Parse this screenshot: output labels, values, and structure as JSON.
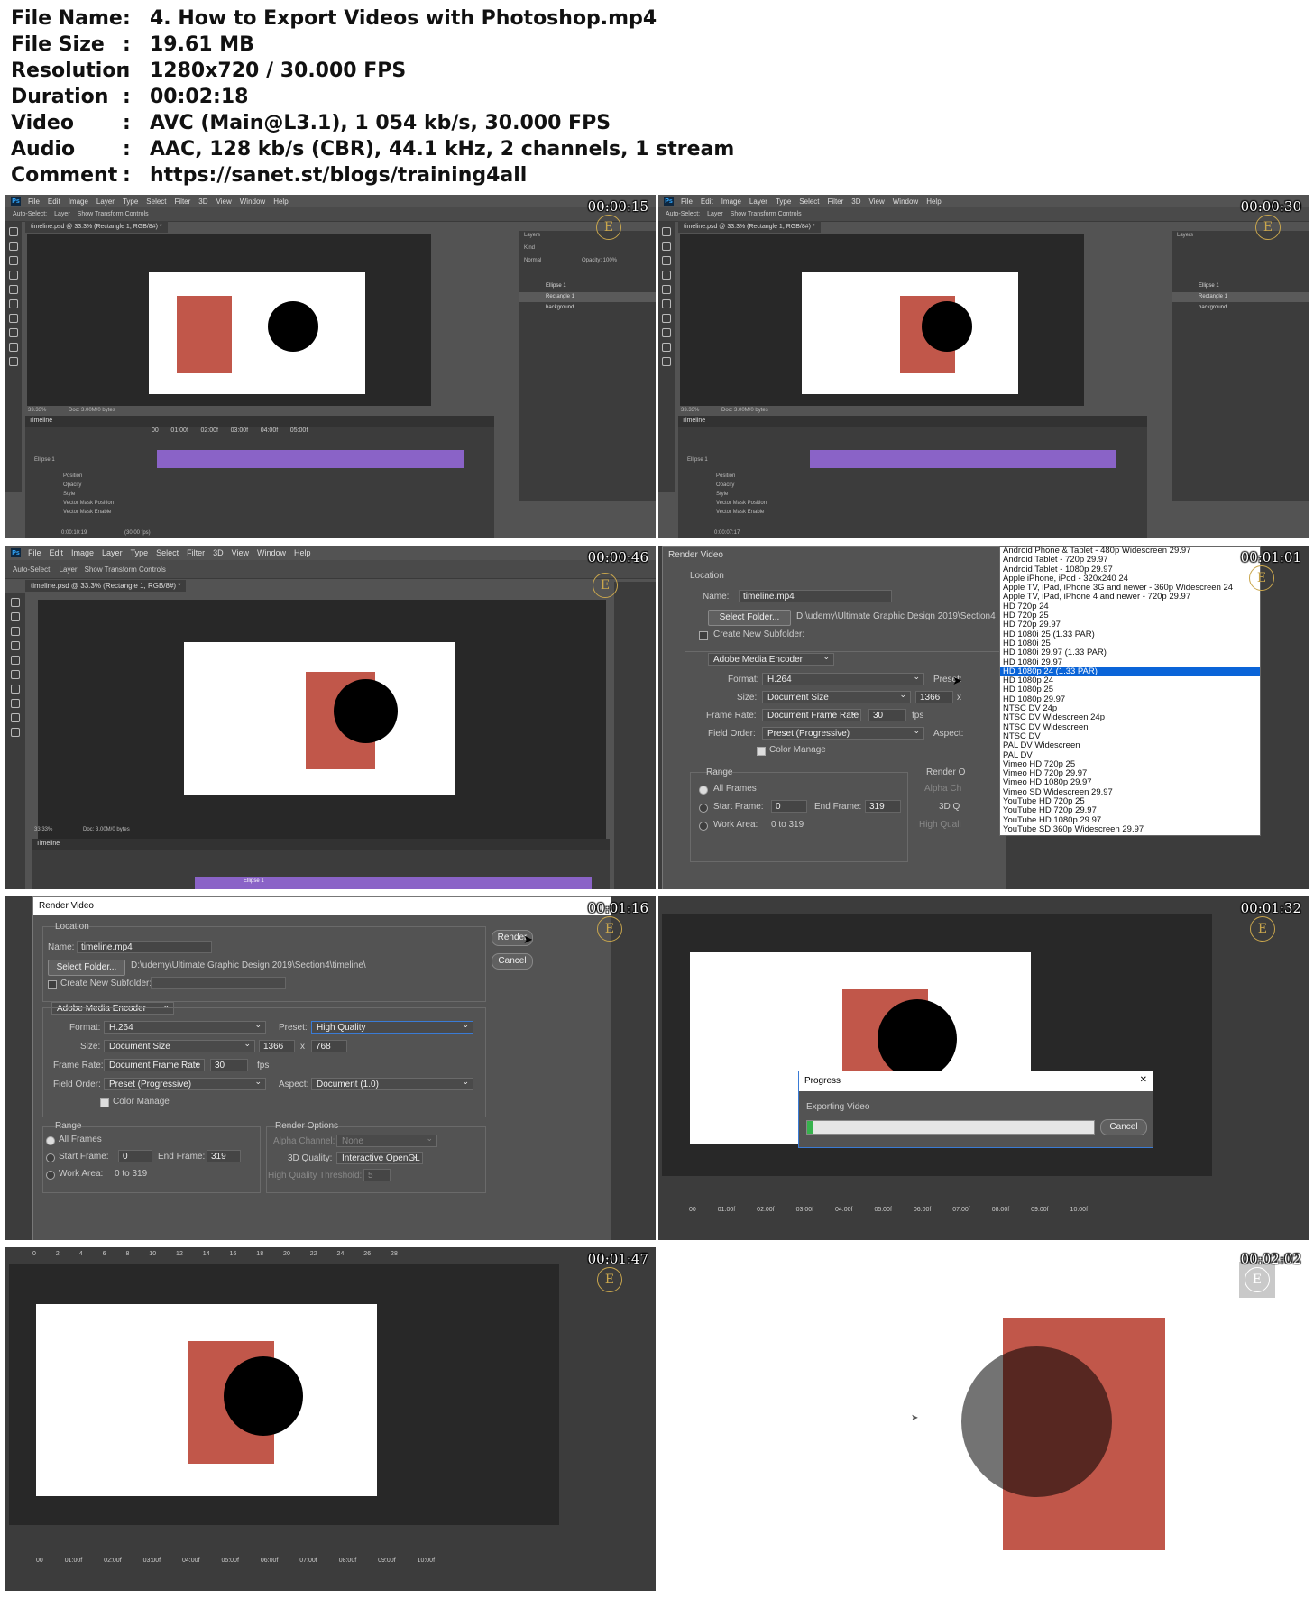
{
  "info": [
    {
      "key": "File Name",
      "value": "4. How to Export Videos with Photoshop.mp4"
    },
    {
      "key": "File Size",
      "value": "19.61 MB"
    },
    {
      "key": "Resolution",
      "value": "1280x720 / 30.000 FPS"
    },
    {
      "key": "Duration",
      "value": "00:02:18"
    },
    {
      "key": "Video",
      "value": "AVC (Main@L3.1), 1 054 kb/s, 30.000 FPS"
    },
    {
      "key": "Audio",
      "value": "AAC, 128 kb/s (CBR), 44.1 kHz, 2 channels, 1 stream"
    },
    {
      "key": "Comment",
      "value": "https://sanet.st/blogs/training4all"
    }
  ],
  "separator": ":",
  "photoshop": {
    "menu": [
      "File",
      "Edit",
      "Image",
      "Layer",
      "Type",
      "Select",
      "Filter",
      "3D",
      "View",
      "Window",
      "Help"
    ],
    "ps_logo": "Ps",
    "auto_select": "Auto-Select:",
    "auto_select_value": "Layer",
    "transform_controls": "Show Transform Controls",
    "doc_tab": "timeline.psd @ 33.3% (Rectangle 1, RGB/8#) *",
    "zoom": "33.33%",
    "doc_size": "Doc: 3.00M/0 bytes",
    "timeline_title": "Timeline",
    "layers_title": "Layers",
    "kind": "Kind",
    "blend": "Normal",
    "opacity": "Opacity: 100%",
    "layers": [
      "Ellipse 1",
      "Rectangle 1",
      "background"
    ],
    "track_name": "Ellipse 1",
    "track_props": [
      "Position",
      "Opacity",
      "Style",
      "Vector Mask Position",
      "Vector Mask Enable"
    ],
    "timecode_1": "0:00:10:19",
    "timecode_2": "0:00:07:17",
    "fps": "(30.00 fps)",
    "ruler": [
      "00",
      "01:00f",
      "02:00f",
      "03:00f",
      "04:00f",
      "05:00f",
      "06:00f",
      "07:00f",
      "08:00f",
      "09:00f",
      "10:00f"
    ],
    "ruler_marks": [
      "0",
      "2",
      "4",
      "6",
      "8",
      "10",
      "12",
      "14",
      "16",
      "18",
      "20",
      "22",
      "24",
      "26",
      "28"
    ]
  },
  "thumbs": [
    {
      "timestamp": "00:00:15"
    },
    {
      "timestamp": "00:00:30"
    },
    {
      "timestamp": "00:00:46"
    },
    {
      "timestamp": "00:01:01"
    },
    {
      "timestamp": "00:01:16"
    },
    {
      "timestamp": "00:01:32"
    },
    {
      "timestamp": "00:01:47"
    },
    {
      "timestamp": "00:02:02"
    }
  ],
  "render_dialog": {
    "title": "Render Video",
    "location": "Location",
    "name_label": "Name:",
    "name_value": "timeline.mp4",
    "select_folder": "Select Folder...",
    "folder_path": "D:\\udemy\\Ultimate Graphic Design 2019\\Section4\\timeline\\",
    "folder_path_short": "D:\\udemy\\Ultimate Graphic Design 2019\\Section4",
    "create_subfolder": "Create New Subfolder:",
    "encoder": "Adobe Media Encoder",
    "format_label": "Format:",
    "format_value": "H.264",
    "preset_label": "Preset:",
    "preset_value": "High Quality",
    "size_label": "Size:",
    "size_value": "Document Size",
    "width": "1366",
    "x": "x",
    "height": "768",
    "frame_rate_label": "Frame Rate:",
    "frame_rate_value": "Document Frame Rate",
    "fps_value": "30",
    "fps_unit": "fps",
    "field_order_label": "Field Order:",
    "field_order_value": "Preset (Progressive)",
    "aspect_label": "Aspect:",
    "aspect_value": "Document (1.0)",
    "color_manage": "Color Manage",
    "range": "Range",
    "all_frames": "All Frames",
    "start_frame": "Start Frame:",
    "start_value": "0",
    "end_frame": "End Frame:",
    "end_value": "319",
    "work_area": "Work Area:",
    "work_area_value": "0 to 319",
    "render_options": "Render Options",
    "alpha_channel": "Alpha Channel:",
    "alpha_value": "None",
    "quality_3d": "3D Quality:",
    "quality_3d_value": "Interactive OpenGL",
    "hq_threshold": "High Quality Threshold:",
    "hq_value": "5",
    "render_btn": "Render",
    "cancel_btn": "Cancel",
    "render_c": "Render O",
    "alpha_c": "Alpha Ch",
    "q3d_c": "3D Q",
    "hq_c": "High Quali"
  },
  "preset_list": [
    "Android Phone & Tablet - 480p Widescreen 29.97",
    "Android Tablet - 720p 29.97",
    "Android Tablet - 1080p 29.97",
    "Apple iPhone, iPod - 320x240 24",
    "Apple TV, iPad, iPhone 3G and newer - 360p Widescreen 24",
    "Apple TV, iPad, iPhone 4 and newer - 720p 29.97",
    "HD 720p 24",
    "HD 720p 25",
    "HD 720p 29.97",
    "HD 1080i 25 (1.33 PAR)",
    "HD 1080i 25",
    "HD 1080i 29.97 (1.33 PAR)",
    "HD 1080i 29.97",
    "HD 1080p 24 (1.33 PAR)",
    "HD 1080p 24",
    "HD 1080p 25",
    "HD 1080p 29.97",
    "NTSC DV 24p",
    "NTSC DV Widescreen 24p",
    "NTSC DV Widescreen",
    "NTSC DV",
    "PAL DV Widescreen",
    "PAL DV",
    "Vimeo HD 720p 25",
    "Vimeo HD 720p 29.97",
    "Vimeo HD 1080p 29.97",
    "Vimeo SD Widescreen 29.97",
    "YouTube HD 720p 25",
    "YouTube HD 720p 29.97",
    "YouTube HD 1080p 29.97",
    "YouTube SD 360p Widescreen 29.97"
  ],
  "selected_preset_index": 13,
  "progress": {
    "title": "Progress",
    "close": "✕",
    "message": "Exporting Video",
    "cancel": "Cancel",
    "fraction": 0.02
  },
  "watermark": "E",
  "colors": {
    "rect": "#c1574a",
    "ellipse": "#000000",
    "ps_bg": "#535353",
    "canvas": "#282828",
    "timeline_clip": "#8a63c7",
    "accent": "#0a64d8"
  }
}
